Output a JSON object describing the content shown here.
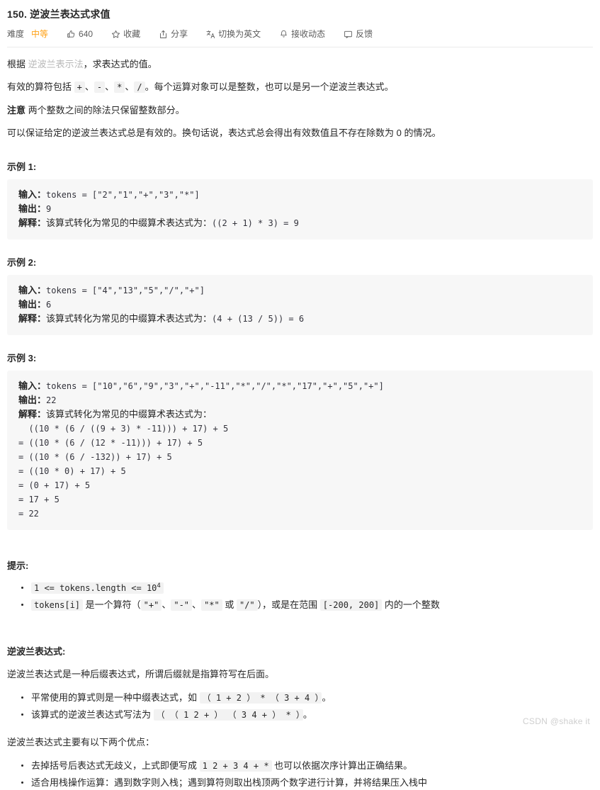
{
  "header": {
    "title": "150. 逆波兰表达式求值",
    "difficulty_label": "难度",
    "difficulty_value": "中等",
    "difficulty_color": "#ffa116",
    "actions": [
      {
        "icon": "thumbs-up-icon",
        "label": "640"
      },
      {
        "icon": "star-icon",
        "label": "收藏"
      },
      {
        "icon": "share-icon",
        "label": "分享"
      },
      {
        "icon": "translate-icon",
        "label": "切换为英文"
      },
      {
        "icon": "bell-icon",
        "label": "接收动态"
      },
      {
        "icon": "feedback-icon",
        "label": "反馈"
      }
    ]
  },
  "description": {
    "p1_before": "根据 ",
    "p1_link": "逆波兰表示法",
    "p1_after": "，求表达式的值。",
    "p2_before": "有效的算符包括 ",
    "p2_ops": [
      "+",
      "-",
      "*",
      "/"
    ],
    "p2_sep": "、",
    "p2_after": "。每个运算对象可以是整数，也可以是另一个逆波兰表达式。",
    "p3_bold": "注意",
    "p3_rest": " 两个整数之间的除法只保留整数部分。",
    "p4": "可以保证给定的逆波兰表达式总是有效的。换句话说，表达式总会得出有效数值且不存在除数为 0 的情况。"
  },
  "labels": {
    "input": "输入：",
    "output": "输出：",
    "explain": "解释："
  },
  "examples": [
    {
      "title": "示例 1:",
      "input_code": "tokens = [\"2\",\"1\",\"+\",\"3\",\"*\"]",
      "output_value": "9",
      "explain_text": "该算式转化为常见的中缀算术表达式为：",
      "explain_code": "((2 + 1) * 3) = 9",
      "calc_lines": []
    },
    {
      "title": "示例 2:",
      "input_code": "tokens = [\"4\",\"13\",\"5\",\"/\",\"+\"]",
      "output_value": "6",
      "explain_text": "该算式转化为常见的中缀算术表达式为：",
      "explain_code": "(4 + (13 / 5)) = 6",
      "calc_lines": []
    },
    {
      "title": "示例 3:",
      "input_code": "tokens = [\"10\",\"6\",\"9\",\"3\",\"+\",\"-11\",\"*\",\"/\",\"*\",\"17\",\"+\",\"5\",\"+\"]",
      "output_value": "22",
      "explain_text": "该算式转化为常见的中缀算术表达式为：",
      "explain_code": "",
      "calc_lines": [
        "  ((10 * (6 / ((9 + 3) * -11))) + 17) + 5",
        "= ((10 * (6 / (12 * -11))) + 17) + 5",
        "= ((10 * (6 / -132)) + 17) + 5",
        "= ((10 * 0) + 17) + 5",
        "= (0 + 17) + 5",
        "= 17 + 5",
        "= 22"
      ]
    }
  ],
  "hints": {
    "title": "提示:",
    "item1_code_a": "1 <= tokens.length <= 10",
    "item1_code_sup": "4",
    "item2": {
      "code_tokens": "tokens[i]",
      "t1": " 是一个算符（",
      "c1": "\"+\"",
      "t2": "、",
      "c2": "\"-\"",
      "t3": "、",
      "c3": "\"*\"",
      "t4": " 或 ",
      "c4": "\"/\"",
      "t5": "），或是在范围 ",
      "c5": "[-200, 200]",
      "t6": " 内的一个整数"
    }
  },
  "rpn": {
    "title": "逆波兰表达式:",
    "intro": "逆波兰表达式是一种后缀表达式，所谓后缀就是指算符写在后面。",
    "bullets": [
      {
        "text_before": "平常使用的算式则是一种中缀表达式，如 ",
        "code": "（ 1 + 2 ） * （ 3 + 4 ）",
        "text_after": "。"
      },
      {
        "text_before": "该算式的逆波兰表达式写法为 ",
        "code": "（ （ 1 2 + ） （ 3 4 + ） * ）",
        "text_after": "。"
      }
    ],
    "advantages_intro": "逆波兰表达式主要有以下两个优点：",
    "advantages": [
      {
        "text_before": "去掉括号后表达式无歧义，上式即便写成 ",
        "code": "1 2 + 3 4 + *",
        "text_after": " 也可以依据次序计算出正确结果。"
      },
      {
        "text_before": "适合用栈操作运算：遇到数字则入栈；遇到算符则取出栈顶两个数字进行计算，并将结果压入栈中",
        "code": "",
        "text_after": ""
      }
    ]
  },
  "watermark": "CSDN @shake it"
}
